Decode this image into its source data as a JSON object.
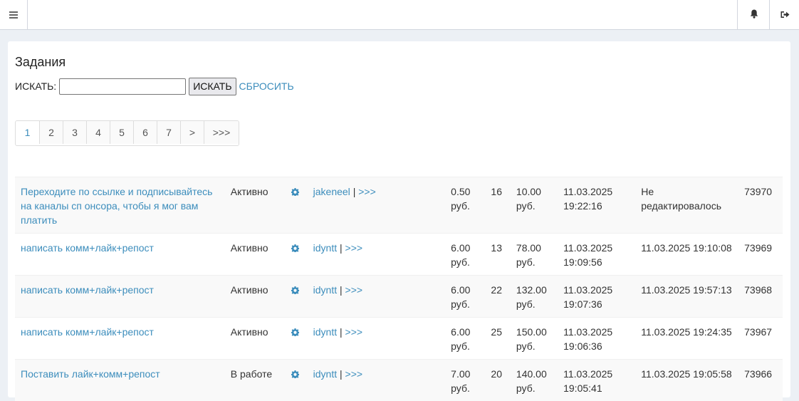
{
  "header": {
    "menu_icon": "hamburger-icon",
    "bell_icon": "bell-icon",
    "logout_icon": "sign-out-icon"
  },
  "page": {
    "title": "Задания"
  },
  "search": {
    "label": "ИСКАТЬ:",
    "value": "",
    "button_label": "ИСКАТЬ",
    "reset_label": "СБРОСИТЬ"
  },
  "pagination": [
    "1",
    "2",
    "3",
    "4",
    "5",
    "6",
    "7",
    ">",
    ">>>"
  ],
  "pagination_active": "1",
  "rows": [
    {
      "name": "Переходите по ссылке и подписывайтесь на каналы сп онсора, чтобы я мог вам платить",
      "status": "Активно",
      "user": "jakeneel",
      "more": ">>>",
      "price": "0.50 руб.",
      "count": "16",
      "total": "10.00 руб.",
      "created": "11.03.2025 19:22:16",
      "edited": "Не редактировалось",
      "id": "73970"
    },
    {
      "name": "написать комм+лайк+репост",
      "status": "Активно",
      "user": "idyntt",
      "more": ">>>",
      "price": "6.00 руб.",
      "count": "13",
      "total": "78.00 руб.",
      "created": "11.03.2025 19:09:56",
      "edited": "11.03.2025 19:10:08",
      "id": "73969"
    },
    {
      "name": "написать комм+лайк+репост",
      "status": "Активно",
      "user": "idyntt",
      "more": ">>>",
      "price": "6.00 руб.",
      "count": "22",
      "total": "132.00 руб.",
      "created": "11.03.2025 19:07:36",
      "edited": "11.03.2025 19:57:13",
      "id": "73968"
    },
    {
      "name": "написать комм+лайк+репост",
      "status": "Активно",
      "user": "idyntt",
      "more": ">>>",
      "price": "6.00 руб.",
      "count": "25",
      "total": "150.00 руб.",
      "created": "11.03.2025 19:06:36",
      "edited": "11.03.2025 19:24:35",
      "id": "73967"
    },
    {
      "name": "Поставить лайк+комм+репост",
      "status": "В работе",
      "user": "idyntt",
      "more": ">>>",
      "price": "7.00 руб.",
      "count": "20",
      "total": "140.00 руб.",
      "created": "11.03.2025 19:05:41",
      "edited": "11.03.2025 19:05:58",
      "id": "73966"
    }
  ],
  "colors": {
    "accent": "#3c8dbc",
    "background": "#ecf0f5",
    "stripe": "#f9f9f9"
  }
}
